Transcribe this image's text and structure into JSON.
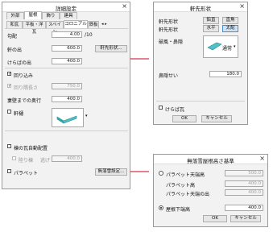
{
  "detail": {
    "title": "詳細設定",
    "close": "×",
    "tabs": [
      "外部",
      "屋根",
      "飾り",
      "建具"
    ],
    "subtabs": [
      "和瓦",
      "平板・洋瓦",
      "スペイン",
      "コロニアル",
      "鉄板"
    ],
    "subtab_scroll": "◂ ▸",
    "kobai_label": "勾配",
    "kobai_value": "4.00",
    "kobai_unit": "/10",
    "nokinode_label": "軒の出",
    "nokinode_value": "600.0",
    "nokisaki_btn": "軒先形状...",
    "keraba_label": "けらばの出",
    "keraba_value": "400.0",
    "tarukomi_label": "回り込み",
    "mawarishoku_label": "回り隅長さ",
    "mawarishoku_value": "750.0",
    "sodarouka_label": "妻壁までの奥行",
    "sodarouka_value": "400.0",
    "noki_label": "軒樋",
    "sadori_label": "棟の瓦自動配置",
    "sadori2_label": "陸り棟",
    "sadori2_suffix": "逃げ",
    "sadori2_value": "400.0",
    "parapet_label": "パラペット",
    "parapet_btn": "無落雪設定..."
  },
  "nokisaki": {
    "title": "軒先形状",
    "close": "×",
    "row1_label": "軒先形状",
    "row2_label": "軒先形状",
    "btn_chokkaku": "鉛直",
    "btn_suichoku": "直角",
    "btn_suihei": "水平",
    "btn_taiha": "太配",
    "hafu_label": "破風・鼻隠",
    "combo_value": "通常",
    "combo_arrow": "▾",
    "hankeishin_label": "鼻隠せい",
    "hankeishin_value": "180.0",
    "keraba_chk_label": "けらば瓦",
    "ok": "OK",
    "cancel": "キャンセル"
  },
  "murakusetsu": {
    "title": "無落雪屋根高さ基準",
    "close": "×",
    "opt1_label": "パラペット天端高",
    "opt1_value": "500.0",
    "parapet_high_label": "パラペット高",
    "parapet_high_value": "400.0",
    "parapet_out_label": "パラペット天端の出",
    "parapet_out_value": "400.0",
    "opt2_label": "屋根下端高",
    "opt2_value": "400.0",
    "ok": "OK",
    "cancel": "キャンセル"
  }
}
